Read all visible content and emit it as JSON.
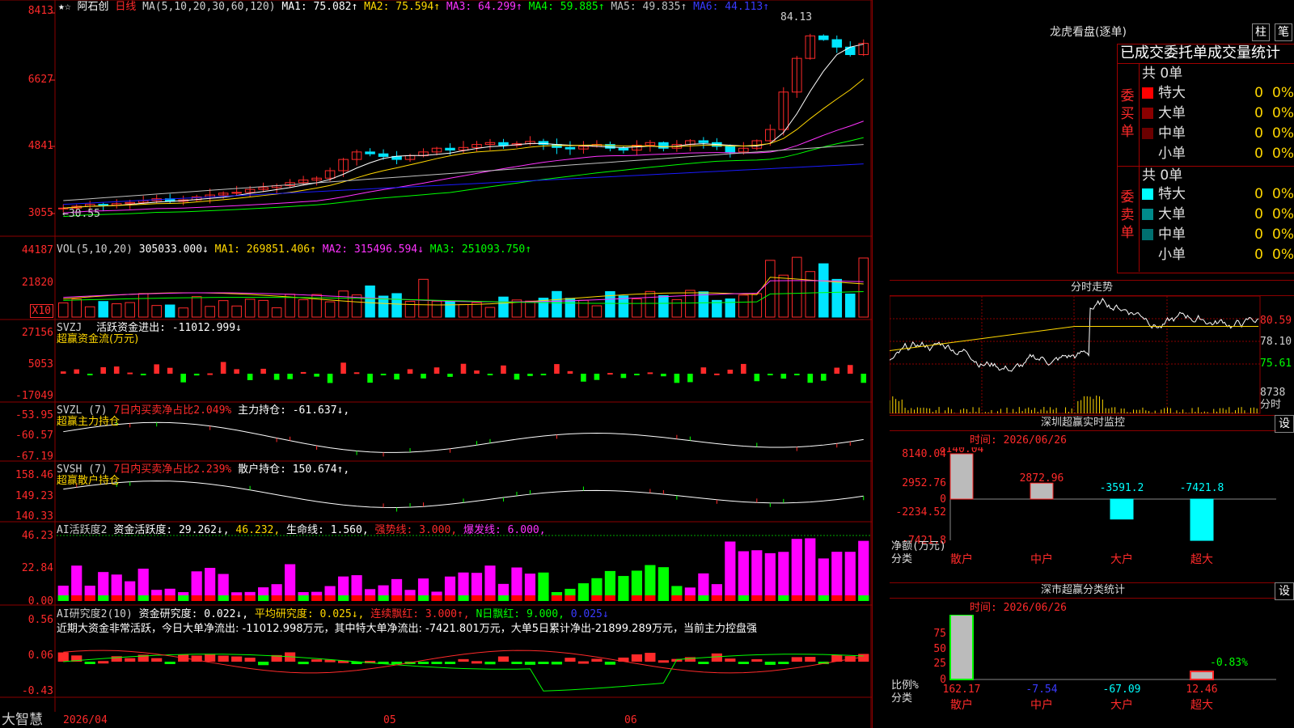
{
  "colors": {
    "up": "#ff2a2a",
    "down": "#00e5ff",
    "grid": "#8b0000",
    "ma1": "#ffffff",
    "ma2": "#ffd700",
    "ma3": "#ff33ff",
    "ma4": "#00ff00",
    "ma5": "#c0c0c0",
    "ma6": "#1a1aff"
  },
  "main": {
    "stock_name": "阿石创",
    "period": "日线",
    "ma_params": "MA(5,10,20,30,60,120)",
    "ma1": "MA1: 75.082↑",
    "ma2": "MA2: 75.594↑",
    "ma3": "MA3: 64.299↑",
    "ma4": "MA4: 59.885↑",
    "ma5": "MA5: 49.835↑",
    "ma6": "MA6: 44.113↑",
    "high_label": "84.13",
    "low_label": "←30.55",
    "yticks": [
      "8413",
      "6627",
      "4841",
      "3055"
    ]
  },
  "vol": {
    "header": "VOL(5,10,20)",
    "value": "305033.000↓",
    "ma1": "MA1: 269851.406↑",
    "ma2": "MA2: 315496.594↓",
    "ma3": "MA3: 251093.750↑",
    "yticks": [
      "44187",
      "21820"
    ],
    "unit": "X10"
  },
  "svzj": {
    "name": "SVZJ",
    "label": "活跃资金进出: -11012.999↓",
    "sub": "超赢资金流(万元)",
    "yticks": [
      "27156",
      "5053",
      "-17049"
    ]
  },
  "svzl": {
    "name": "SVZL (7)",
    "ratio": "7日内买卖净占比2.049%",
    "hold": "主力持仓: -61.637↓,",
    "sub": "超赢主力持仓",
    "yticks": [
      "-53.95",
      "-60.57",
      "-67.19"
    ]
  },
  "svsh": {
    "name": "SVSH (7)",
    "ratio": "7日内买卖净占比2.239%",
    "hold": "散户持仓: 150.674↑,",
    "sub": "超赢散户持仓",
    "yticks": [
      "158.46",
      "149.23",
      "140.33"
    ]
  },
  "ai1": {
    "name": "AI活跃度2",
    "l1": "资金活跃度: 29.262↓,",
    "l2": "46.232,",
    "l3": "生命线: 1.560,",
    "l4": "强势线: 3.000,",
    "l5": "爆发线: 6.000,",
    "yticks": [
      "46.23",
      "22.84",
      "0.00"
    ]
  },
  "ai2": {
    "name": "AI研究度2(10)",
    "l1": "资金研究度: 0.022↓,",
    "l2": "平均研究度: 0.025↓,",
    "l3": "连续飘红: 3.000↑,",
    "l4": "N日飘红: 9.000,",
    "l5": "0.025↓",
    "summary": "近期大资金非常活跃，今日大单净流出: -11012.998万元，其中特大单净流出: -7421.801万元，大单5日累计净出-21899.289万元，当前主力控盘强",
    "yticks": [
      "0.56",
      "0.06",
      "-0.43"
    ]
  },
  "bottom": {
    "brand": "大智慧",
    "date": "2026/04",
    "m05": "05",
    "m06": "06"
  },
  "lhb": {
    "title": "龙虎看盘(逐单)",
    "btn_zhu": "柱",
    "btn_bi": "笔",
    "subtitle": "已成交委托单成交量统计",
    "buy_total": "共 0单",
    "buy_side": [
      "委",
      "买",
      "单"
    ],
    "sell_total": "共 0单",
    "sell_side": [
      "委",
      "卖",
      "单"
    ],
    "buy_rows": [
      {
        "label": "特大",
        "n": "0",
        "p": "0%"
      },
      {
        "label": "大单",
        "n": "0",
        "p": "0%"
      },
      {
        "label": "中单",
        "n": "0",
        "p": "0%"
      },
      {
        "label": "小单",
        "n": "0",
        "p": "0%"
      }
    ],
    "sell_rows": [
      {
        "label": "特大",
        "n": "0",
        "p": "0%"
      },
      {
        "label": "大单",
        "n": "0",
        "p": "0%"
      },
      {
        "label": "中单",
        "n": "0",
        "p": "0%"
      },
      {
        "label": "小单",
        "n": "0",
        "p": "0%"
      }
    ],
    "buy_colors": [
      "#ff0000",
      "#8b0000",
      "#6b0000",
      ""
    ],
    "sell_colors": [
      "#00ffff",
      "#008b8b",
      "#007070",
      ""
    ]
  },
  "intraday": {
    "title": "分时走势",
    "prices": [
      "80.59",
      "78.10",
      "75.61"
    ],
    "vol": "8738",
    "unit": "分时"
  },
  "sz_monitor": {
    "title": "深圳超赢实时监控",
    "btn": "设",
    "time": "时间: 2026/06/26",
    "yticks": [
      "8140.04",
      "2952.76",
      "0",
      "-2234.52",
      "-7421.8"
    ],
    "ylabel": "净额(万元)",
    "xlabel": "分类",
    "chart_data": {
      "type": "bar",
      "categories": [
        "散户",
        "中户",
        "大户",
        "超大"
      ],
      "values": [
        8140.04,
        2872.96,
        -3591.2,
        -7421.8
      ],
      "value_labels": [
        "8140.04",
        "2872.96",
        "-3591.2",
        "-7421.8"
      ],
      "ylim": [
        -7421.8,
        8140.04
      ]
    }
  },
  "sz_stats": {
    "title": "深市超赢分类统计",
    "btn": "设",
    "time": "时间: 2026/06/26",
    "yticks": [
      "75",
      "50",
      "25",
      "0"
    ],
    "ylabel": "比例%",
    "xlabel": "分类",
    "chart_data": {
      "type": "bar",
      "categories": [
        "散户",
        "中户",
        "大户",
        "超大"
      ],
      "values": [
        162.17,
        -7.54,
        -67.09,
        12.46
      ],
      "value_labels": [
        "162.17",
        "-7.54",
        "-67.09",
        "12.46"
      ],
      "extra_label": "-0.83%"
    }
  }
}
